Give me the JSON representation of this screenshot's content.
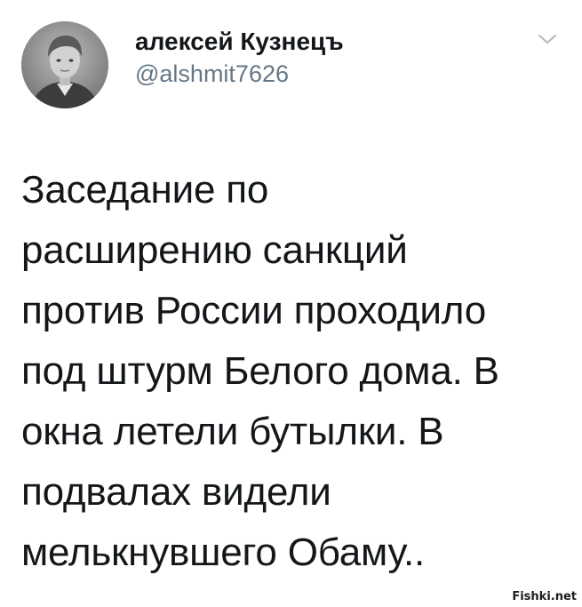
{
  "tweet": {
    "author": {
      "display_name": "алексей Кузнецъ",
      "handle": "@alshmit7626",
      "avatar_icon": "user-photo-avatar"
    },
    "menu_icon": "chevron-down-icon",
    "text": "Заседание по\nрасширению санкций\nпротив России проходило\nпод штурм Белого дома. В\nокна летели бутылки. В\nподвалах видели\nмелькнувшего Обаму.."
  },
  "watermark": "Fishki.net",
  "colors": {
    "text": "#14171a",
    "secondary": "#657786",
    "chevron": "#aab8c2",
    "background": "#ffffff"
  }
}
